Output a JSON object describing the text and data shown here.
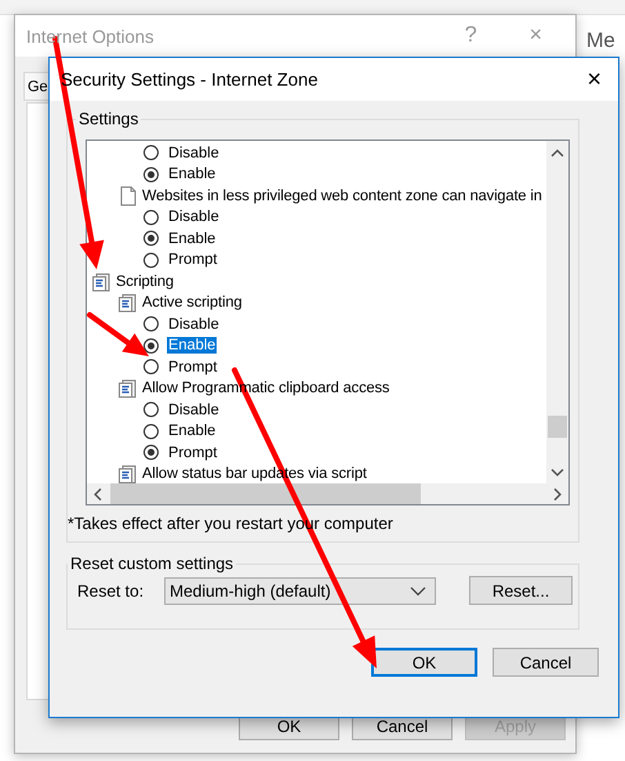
{
  "back_window": {
    "title": "Internet Options",
    "help": "?",
    "close": "×",
    "tab": "Ge",
    "side_text": "Me",
    "buttons": [
      {
        "label": "OK",
        "disabled": false
      },
      {
        "label": "Cancel",
        "disabled": false
      },
      {
        "label": "Apply",
        "disabled": true
      }
    ]
  },
  "dialog": {
    "title": "Security Settings - Internet Zone",
    "close": "×",
    "settings_group": "Settings",
    "tree": [
      {
        "kind": "continued",
        "children": [
          {
            "kind": "continued",
            "children": [
              {
                "kind": "radio",
                "label": "Disable",
                "selected": false,
                "highlighted": false
              },
              {
                "kind": "radio",
                "label": "Enable",
                "selected": true,
                "highlighted": false
              }
            ]
          },
          {
            "kind": "page",
            "label": "Websites in less privileged web content zone can navigate in",
            "children": [
              {
                "kind": "radio",
                "label": "Disable",
                "selected": false,
                "highlighted": false
              },
              {
                "kind": "radio",
                "label": "Enable",
                "selected": true,
                "highlighted": false
              },
              {
                "kind": "radio",
                "label": "Prompt",
                "selected": false,
                "highlighted": false
              }
            ]
          }
        ]
      },
      {
        "kind": "script",
        "label": "Scripting",
        "children": [
          {
            "kind": "script",
            "label": "Active scripting",
            "children": [
              {
                "kind": "radio",
                "label": "Disable",
                "selected": false,
                "highlighted": false
              },
              {
                "kind": "radio",
                "label": "Enable",
                "selected": true,
                "highlighted": true
              },
              {
                "kind": "radio",
                "label": "Prompt",
                "selected": false,
                "highlighted": false
              }
            ]
          },
          {
            "kind": "script",
            "label": "Allow Programmatic clipboard access",
            "children": [
              {
                "kind": "radio",
                "label": "Disable",
                "selected": false,
                "highlighted": false
              },
              {
                "kind": "radio",
                "label": "Enable",
                "selected": false,
                "highlighted": false
              },
              {
                "kind": "radio",
                "label": "Prompt",
                "selected": true,
                "highlighted": false
              }
            ]
          },
          {
            "kind": "script",
            "label": "Allow status bar updates via script"
          }
        ]
      }
    ],
    "note": "*Takes effect after you restart your computer",
    "reset_group": "Reset custom settings",
    "reset_label": "Reset to:",
    "reset_value": "Medium-high (default)",
    "reset_button": "Reset...",
    "buttons": [
      {
        "label": "OK",
        "default": true
      },
      {
        "label": "Cancel",
        "default": false
      }
    ]
  }
}
